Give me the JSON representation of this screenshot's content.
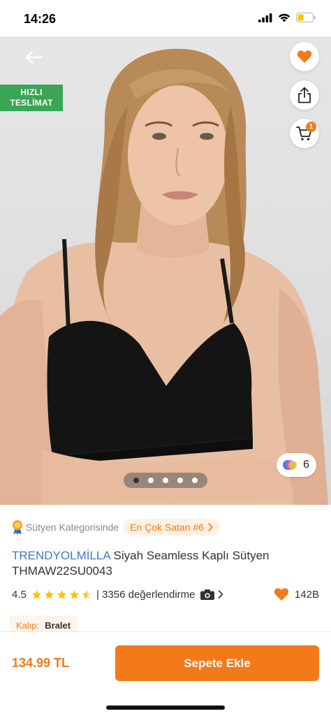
{
  "status": {
    "time": "14:26"
  },
  "hero": {
    "fast_delivery_line1": "HIZLI",
    "fast_delivery_line2": "TESLİMAT",
    "cart_count": "1",
    "color_count": "6",
    "image_count": 5,
    "active_image": 1
  },
  "category": {
    "text": "Sütyen Kategorisinde",
    "best_seller": "En Çok Satan #6"
  },
  "product": {
    "brand": "TRENDYOLMİLLA",
    "name": "Siyah Seamless Kaplı Sütyen THMAW22SU0043"
  },
  "rating": {
    "value": "4.5",
    "stars": 4.5,
    "reviews": "| 3356 değerlendirme",
    "favorites": "142B"
  },
  "fit": {
    "label": "Kalıp:",
    "value": "Bralet"
  },
  "bottom": {
    "price": "134.99 TL",
    "add_to_cart": "Sepete Ekle"
  },
  "colors": {
    "accent": "#f27a1a",
    "brand_blue": "#3b79c9",
    "green_badge": "#3aa655"
  },
  "icons": [
    "back-arrow-icon",
    "heart-icon",
    "share-icon",
    "cart-icon",
    "color-swatch-icon",
    "star-icon",
    "camera-icon",
    "chevron-right-icon",
    "medal-icon"
  ]
}
